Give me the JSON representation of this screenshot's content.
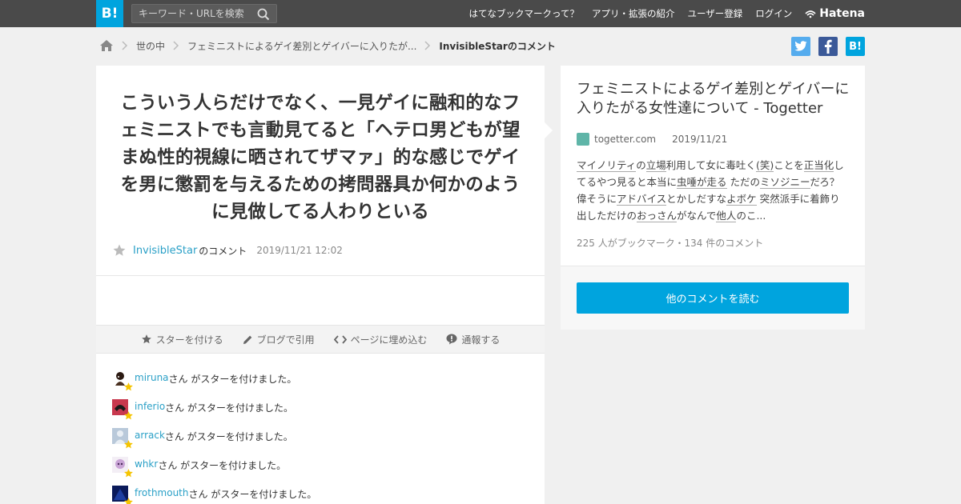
{
  "header": {
    "logo": "B!",
    "search_placeholder": "キーワード・URLを検索",
    "nav": [
      "はてなブックマークって？",
      "アプリ・拡張の紹介",
      "ユーザー登録",
      "ログイン"
    ],
    "brand": "Hatena"
  },
  "breadcrumb": {
    "items": [
      "世の中",
      "フェミニストによるゲイ差別とゲイバーに入りたが..."
    ],
    "current": "InvisibleStarのコメント"
  },
  "share": {
    "hatena_label": "B!"
  },
  "comment": {
    "text": "こういう人らだけでなく、一見ゲイに融和的なフェミニストでも言動見てると「ヘテロ男どもが望まぬ性的視線に晒されてザマァ」的な感じでゲイを男に懲罰を与えるための拷問器具か何かのように見做してる人わりといる",
    "user": "InvisibleStar",
    "suffix": "のコメント",
    "date": "2019/11/21 12:02"
  },
  "actions": [
    "スターを付ける",
    "ブログで引用",
    "ページに埋め込む",
    "通報する"
  ],
  "stars": {
    "message": "さん がスターを付けました。",
    "users": [
      "miruna",
      "inferio",
      "arrack",
      "whkr",
      "frothmouth"
    ]
  },
  "entry": {
    "title": "フェミニストによるゲイ差別とゲイバーに入りたがる女性達について - Togetter",
    "domain": "togetter.com",
    "date": "2019/11/21",
    "summary_parts": [
      {
        "t": "マイノリティ",
        "kw": true
      },
      {
        "t": "の",
        "kw": false
      },
      {
        "t": "立場",
        "kw": true
      },
      {
        "t": "利用して女に毒吐く",
        "kw": false
      },
      {
        "t": "(笑)",
        "kw": true
      },
      {
        "t": "ことを",
        "kw": false
      },
      {
        "t": "正当化",
        "kw": true
      },
      {
        "t": "してるやつ見ると本当に",
        "kw": false
      },
      {
        "t": "虫唾が走る",
        "kw": true
      },
      {
        "t": " ただの",
        "kw": false
      },
      {
        "t": "ミソジニー",
        "kw": true
      },
      {
        "t": "だろ？ 偉そうに",
        "kw": false
      },
      {
        "t": "アドバイス",
        "kw": true
      },
      {
        "t": "とかしだすな",
        "kw": false
      },
      {
        "t": "よボケ",
        "kw": true
      },
      {
        "t": " 突然派手に着飾り出しただけの",
        "kw": false
      },
      {
        "t": "おっさん",
        "kw": true
      },
      {
        "t": "がなんで",
        "kw": false
      },
      {
        "t": "他人",
        "kw": true
      },
      {
        "t": "のこ...",
        "kw": false
      }
    ],
    "counts": "225 人がブックマーク・134 件のコメント",
    "read_more": "他のコメントを読む"
  },
  "colors": {
    "brand_blue": "#00a4de",
    "link": "#2aa0c7",
    "twitter": "#55acee",
    "facebook": "#3b5998",
    "star": "#f5c400"
  }
}
